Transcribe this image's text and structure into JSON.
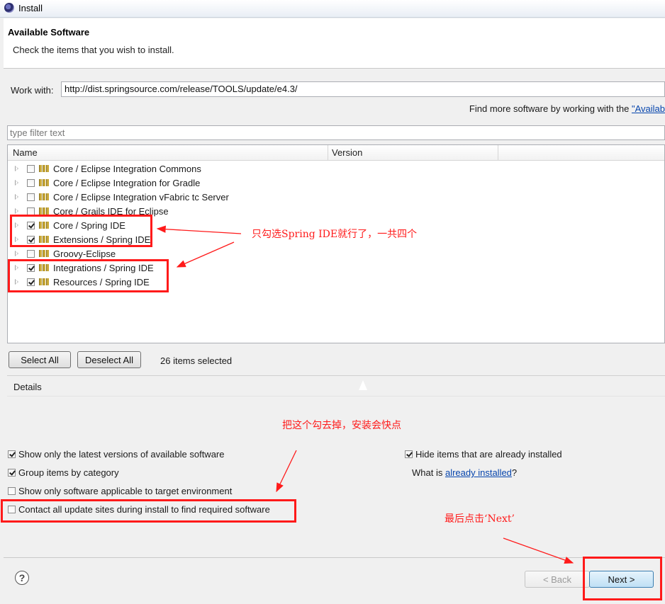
{
  "window": {
    "title": "Install"
  },
  "header": {
    "title": "Available Software",
    "subtitle": "Check the items that you wish to install."
  },
  "work_with": {
    "label": "Work with:",
    "value": "http://dist.springsource.com/release/TOOLS/update/e4.3/"
  },
  "find_more": {
    "text": "Find more software by working with the ",
    "link": "\"Availab"
  },
  "filter": {
    "placeholder": "type filter text"
  },
  "tree": {
    "columns": [
      "Name",
      "Version"
    ],
    "rows": [
      {
        "label": "Core / Eclipse Integration Commons",
        "checked": false
      },
      {
        "label": "Core / Eclipse Integration for Gradle",
        "checked": false
      },
      {
        "label": "Core / Eclipse Integration vFabric tc Server",
        "checked": false
      },
      {
        "label": "Core / Grails IDE for Eclipse",
        "checked": false
      },
      {
        "label": "Core / Spring IDE",
        "checked": true
      },
      {
        "label": "Extensions / Spring IDE",
        "checked": true
      },
      {
        "label": "Groovy-Eclipse",
        "checked": false
      },
      {
        "label": "Integrations / Spring IDE",
        "checked": true
      },
      {
        "label": "Resources / Spring IDE",
        "checked": true
      }
    ]
  },
  "buttons": {
    "select_all": "Select All",
    "deselect_all": "Deselect All",
    "back": "< Back",
    "next": "Next >"
  },
  "selected_count": "26 items selected",
  "details": {
    "label": "Details"
  },
  "options": {
    "latest_versions": {
      "label": "Show only the latest versions of available software",
      "checked": true
    },
    "group_by_category": {
      "label": "Group items by category",
      "checked": true
    },
    "applicable_only": {
      "label": "Show only software applicable to target environment",
      "checked": false
    },
    "contact_all_sites": {
      "label": "Contact all update sites during install to find required software",
      "checked": false
    },
    "hide_installed": {
      "label": "Hide items that are already installed",
      "checked": true
    }
  },
  "already_installed": {
    "prefix": "What is ",
    "link": "already installed",
    "suffix": "?"
  },
  "annotations": {
    "select_spring": "只勾选Spring IDE就行了，一共四个",
    "uncheck_contact": "把这个勾去掉，安装会快点",
    "click_next": "最后点击‘Next’"
  },
  "colors": {
    "annotation": "#ff1a1a",
    "link": "#0645ad"
  },
  "icons": {
    "app": "eclipse-icon",
    "help": "help-icon",
    "expand": "expand-arrow-icon",
    "package": "feature-package-icon"
  }
}
